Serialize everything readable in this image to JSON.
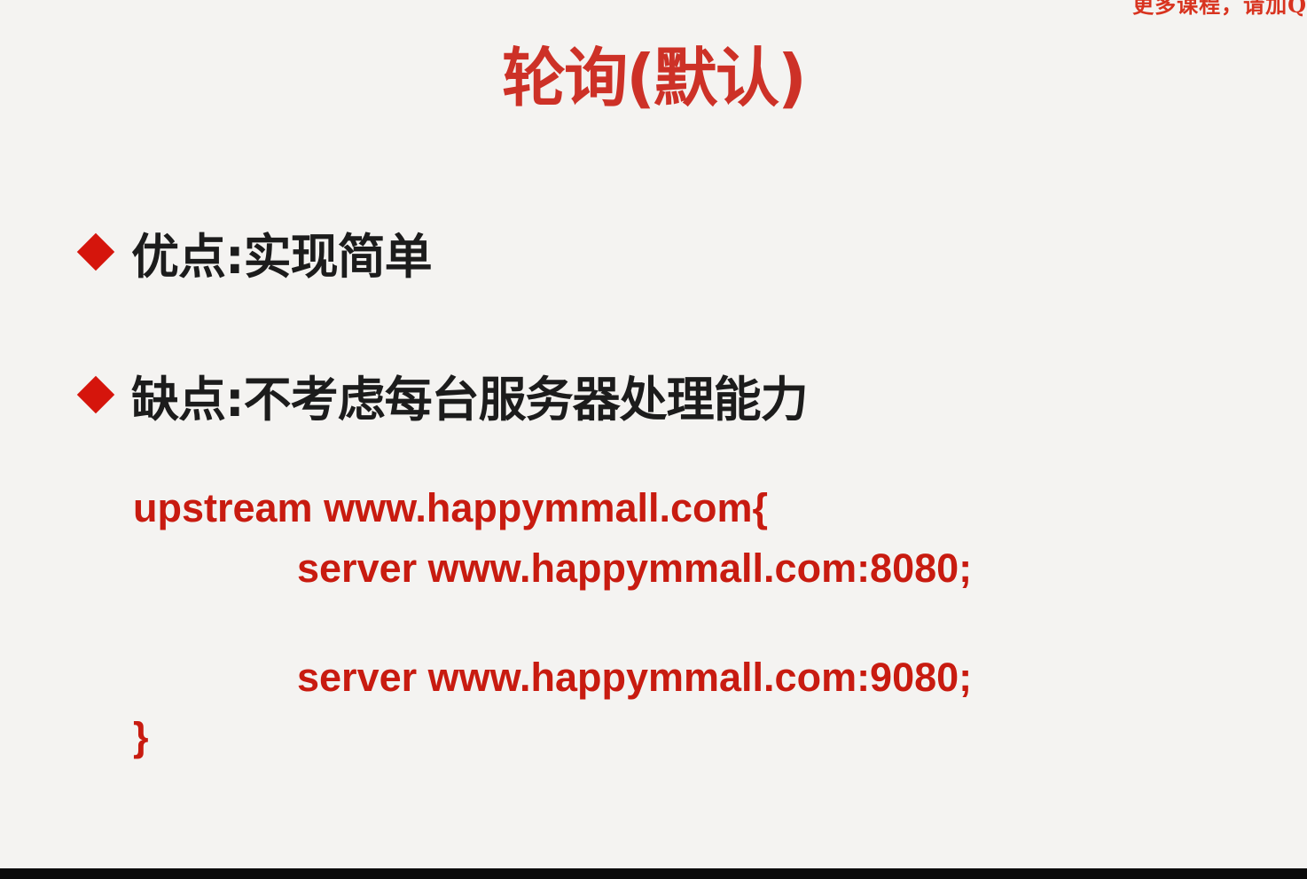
{
  "watermark": "更多课程，请加Q",
  "slide": {
    "title": "轮询(默认)",
    "bullets": [
      {
        "text": "优点:实现简单"
      },
      {
        "text": "缺点:不考虑每台服务器处理能力"
      }
    ],
    "code_lines": [
      "upstream www.happymmall.com{",
      "server www.happymmall.com:8080;",
      "server www.happymmall.com:9080;",
      "}"
    ]
  },
  "colors": {
    "title": "#cd3127",
    "bullet_marker": "#d5150c",
    "code": "#c81b10",
    "body_text": "#1c1c1c",
    "background": "#f4f3f1"
  }
}
